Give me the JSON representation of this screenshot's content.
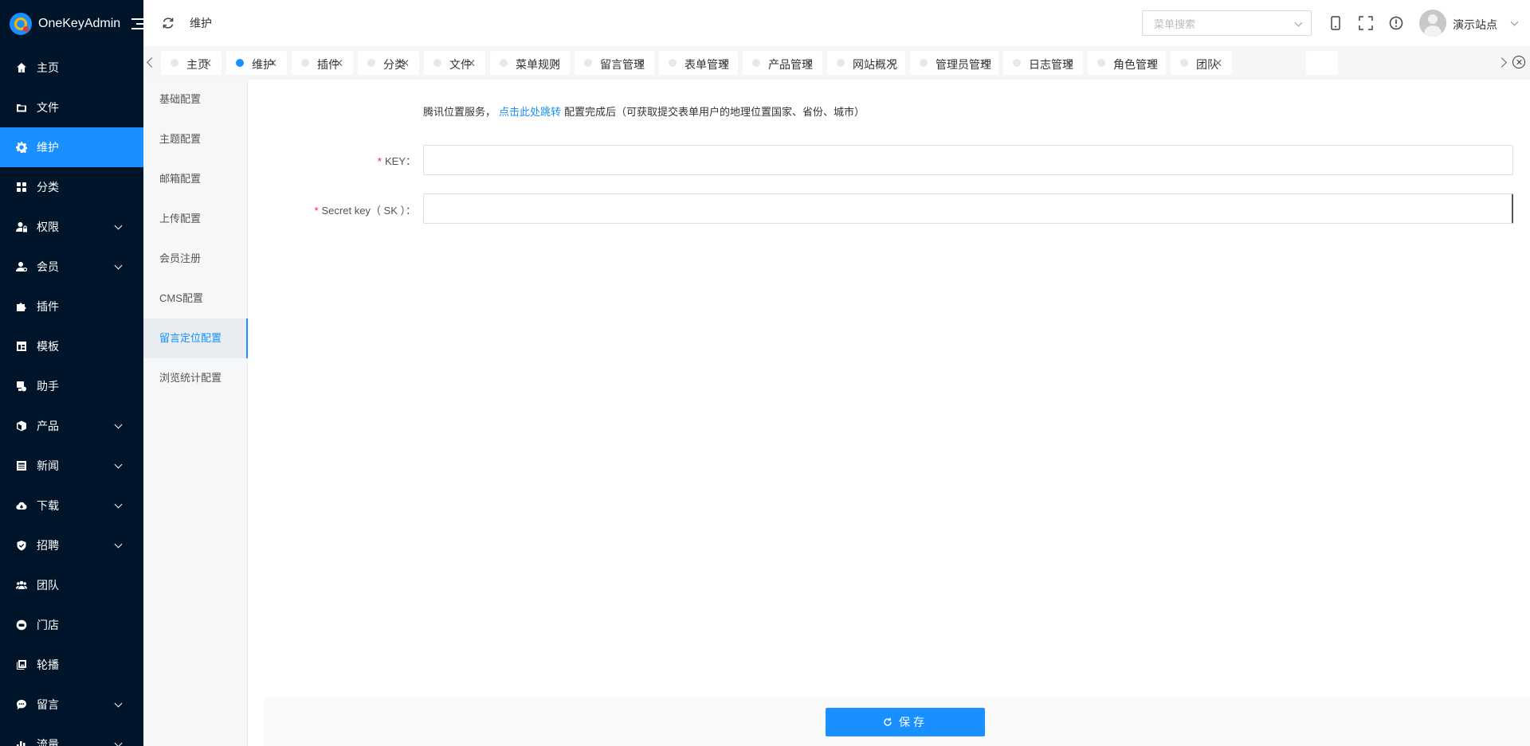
{
  "app": {
    "name": "OneKeyAdmin"
  },
  "sidebar": {
    "items": [
      {
        "label": "主页",
        "icon": "home-icon",
        "expandable": false,
        "active": false
      },
      {
        "label": "文件",
        "icon": "folder-icon",
        "expandable": false,
        "active": false
      },
      {
        "label": "维护",
        "icon": "gear-icon",
        "expandable": false,
        "active": true
      },
      {
        "label": "分类",
        "icon": "grid-icon",
        "expandable": false,
        "active": false
      },
      {
        "label": "权限",
        "icon": "user-lock-icon",
        "expandable": true,
        "active": false
      },
      {
        "label": "会员",
        "icon": "user-icon",
        "expandable": true,
        "active": false
      },
      {
        "label": "插件",
        "icon": "puzzle-icon",
        "expandable": false,
        "active": false
      },
      {
        "label": "模板",
        "icon": "template-icon",
        "expandable": false,
        "active": false
      },
      {
        "label": "助手",
        "icon": "assistant-icon",
        "expandable": false,
        "active": false
      },
      {
        "label": "产品",
        "icon": "box-icon",
        "expandable": true,
        "active": false
      },
      {
        "label": "新闻",
        "icon": "news-icon",
        "expandable": true,
        "active": false
      },
      {
        "label": "下载",
        "icon": "download-icon",
        "expandable": true,
        "active": false
      },
      {
        "label": "招聘",
        "icon": "handshake-icon",
        "expandable": true,
        "active": false
      },
      {
        "label": "团队",
        "icon": "team-icon",
        "expandable": false,
        "active": false
      },
      {
        "label": "门店",
        "icon": "store-icon",
        "expandable": false,
        "active": false
      },
      {
        "label": "轮播",
        "icon": "carousel-icon",
        "expandable": false,
        "active": false
      },
      {
        "label": "留言",
        "icon": "message-icon",
        "expandable": true,
        "active": false
      },
      {
        "label": "流量",
        "icon": "chart-icon",
        "expandable": true,
        "active": false
      }
    ]
  },
  "header": {
    "title": "维护",
    "search_placeholder": "菜单搜索",
    "site_name": "演示站点"
  },
  "tabs": [
    {
      "label": "主页",
      "active": false
    },
    {
      "label": "维护",
      "active": true
    },
    {
      "label": "插件",
      "active": false
    },
    {
      "label": "分类",
      "active": false
    },
    {
      "label": "文件",
      "active": false
    },
    {
      "label": "菜单规则",
      "active": false
    },
    {
      "label": "留言管理",
      "active": false
    },
    {
      "label": "表单管理",
      "active": false
    },
    {
      "label": "产品管理",
      "active": false
    },
    {
      "label": "网站概况",
      "active": false
    },
    {
      "label": "管理员管理",
      "active": false
    },
    {
      "label": "日志管理",
      "active": false
    },
    {
      "label": "角色管理",
      "active": false
    },
    {
      "label": "团队",
      "active": false
    }
  ],
  "config_nav": [
    {
      "label": "基础配置",
      "active": false
    },
    {
      "label": "主题配置",
      "active": false
    },
    {
      "label": "邮箱配置",
      "active": false
    },
    {
      "label": "上传配置",
      "active": false
    },
    {
      "label": "会员注册",
      "active": false
    },
    {
      "label": "CMS配置",
      "active": false
    },
    {
      "label": "留言定位配置",
      "active": true
    },
    {
      "label": "浏览统计配置",
      "active": false
    }
  ],
  "form": {
    "intro_prefix": "腾讯位置服务，",
    "intro_link": "点击此处跳转",
    "intro_suffix": "配置完成后（可获取提交表单用户的地理位置国家、省份、城市）",
    "required_mark": "*",
    "key_label": "KEY：",
    "key_value": "",
    "sk_label": "Secret key（ SK ）：",
    "sk_value": ""
  },
  "footer": {
    "save_label": "保存"
  },
  "colors": {
    "sidebar_bg": "#001529",
    "accent": "#1890ff",
    "required": "#f5222d"
  }
}
